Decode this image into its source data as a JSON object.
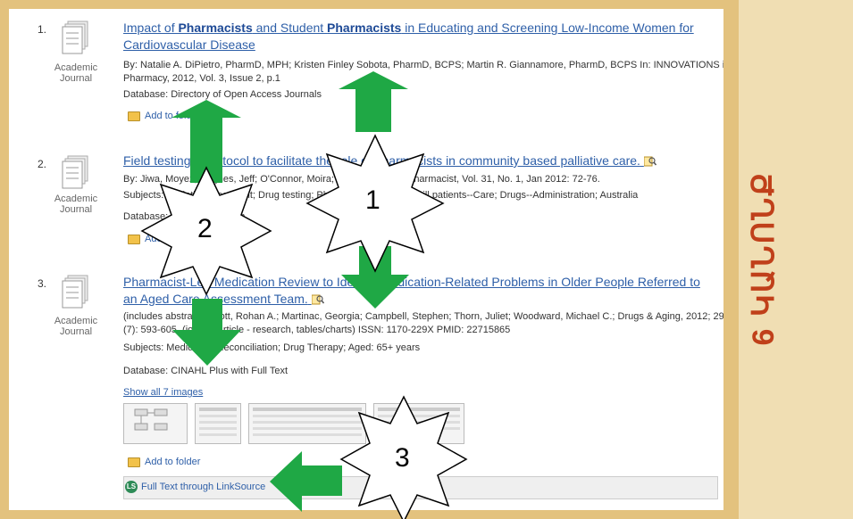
{
  "side_caption": "6 ԿԱՆՈՆՔ",
  "results": [
    {
      "number": "1.",
      "type": "Academic Journal",
      "title_parts": [
        "Impact of ",
        "Pharmacists",
        " and Student ",
        "Pharmacists",
        " in Educating and Screening Low-Income Women for Cardiovascular Disease"
      ],
      "authors_line1": "By: Natalie A. DiPietro, PharmD, MPH; Kristen Finley Sobota, PharmD, BCPS; Martin R. Giannamore, PharmD, BCPS In: INNOVATIONS in",
      "authors_line2": "Pharmacy, 2012, Vol. 3, Issue 2, p.1",
      "database": "Database: Directory of Open Access Journals",
      "add_folder": "Add to folder"
    },
    {
      "number": "2.",
      "type": "Academic Journal",
      "title": "Field testing a protocol to facilitate the role of pharmacists in community based palliative care.",
      "authors_line1": "By: Jiwa, Moyez; Hughes, Jeff; O'Connor, Moira; ... In: Australian Pharmacist, Vol. 31, No. 1, Jan 2012: 72-76.",
      "subjects": "Subjects: Palliative Treatment; Drug testing; Pharmacists; Terminally ill patients--Care; Drugs--Administration; Australia",
      "database": "Database: Health Collection",
      "add_folder": "Add to folder"
    },
    {
      "number": "3.",
      "type": "Academic Journal",
      "title": "Pharmacist-Led Medication Review to Identify Medication-Related Problems in Older People Referred to an Aged Care Assessment Team.",
      "authors_line1": "(includes abstract) Elliott, Rohan A.; Martinac, Georgia; Campbell, Stephen; Thorn, Juliet; Woodward, Michael C.; Drugs & Aging, 2012; 29",
      "authors_line2": "(7): 593-605. (journal article - research, tables/charts) ISSN: 1170-229X PMID: 22715865",
      "subjects": "Subjects: Medication Reconciliation; Drug Therapy; Aged: 65+ years",
      "database": "Database: CINAHL Plus with Full Text",
      "show_images": "Show all 7 images",
      "add_folder": "Add to folder",
      "linksource": "Full Text through LinkSource",
      "ls_logo": "LS"
    }
  ],
  "callouts": [
    "1",
    "2",
    "3"
  ],
  "colors": {
    "frame": "#E3C27E",
    "accent": "#C0401A",
    "arrow": "#1FA845",
    "link": "#2E5FA8"
  }
}
